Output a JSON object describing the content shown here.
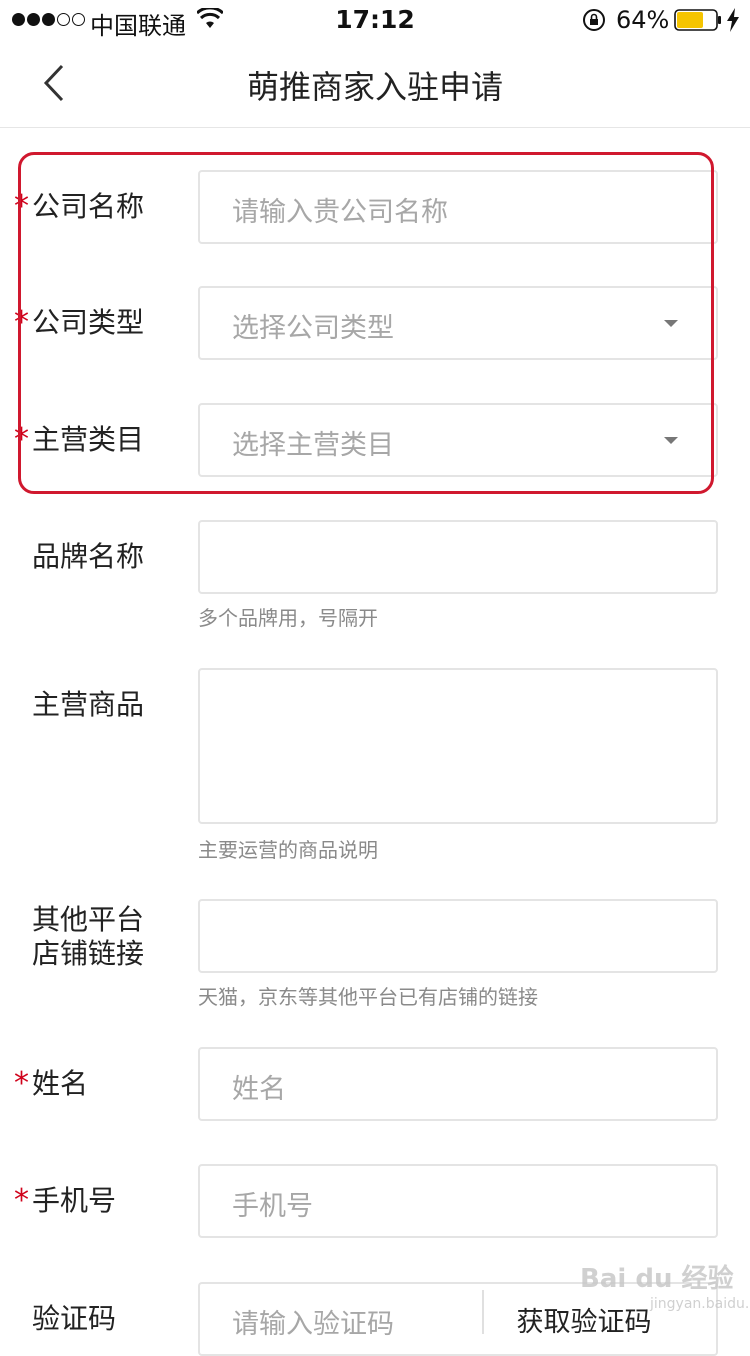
{
  "status_bar": {
    "carrier": "中国联通",
    "time": "17:12",
    "battery": "64%"
  },
  "nav": {
    "title": "萌推商家入驻申请"
  },
  "form": {
    "company_name": {
      "label": "公司名称",
      "required": "*",
      "placeholder": "请输入贵公司名称"
    },
    "company_type": {
      "label": "公司类型",
      "required": "*",
      "placeholder": "选择公司类型"
    },
    "main_category": {
      "label": "主营类目",
      "required": "*",
      "placeholder": "选择主营类目"
    },
    "brand_name": {
      "label": "品牌名称",
      "hint": "多个品牌用，号隔开"
    },
    "main_products": {
      "label": "主营商品",
      "hint": "主要运营的商品说明"
    },
    "other_store_link": {
      "label_line1": "其他平台",
      "label_line2": "店铺链接",
      "hint": "天猫，京东等其他平台已有店铺的链接"
    },
    "name": {
      "label": "姓名",
      "required": "*",
      "placeholder": "姓名"
    },
    "phone": {
      "label": "手机号",
      "required": "*",
      "placeholder": "手机号"
    },
    "verify_code": {
      "label": "验证码",
      "placeholder": "请输入验证码",
      "button": "获取验证码"
    }
  },
  "watermark": {
    "text": "Bai du 经验",
    "sub": "jingyan.baidu.com"
  },
  "colors": {
    "required": "#d0021b",
    "highlight": "#d0182e",
    "battery": "#f5c400"
  }
}
